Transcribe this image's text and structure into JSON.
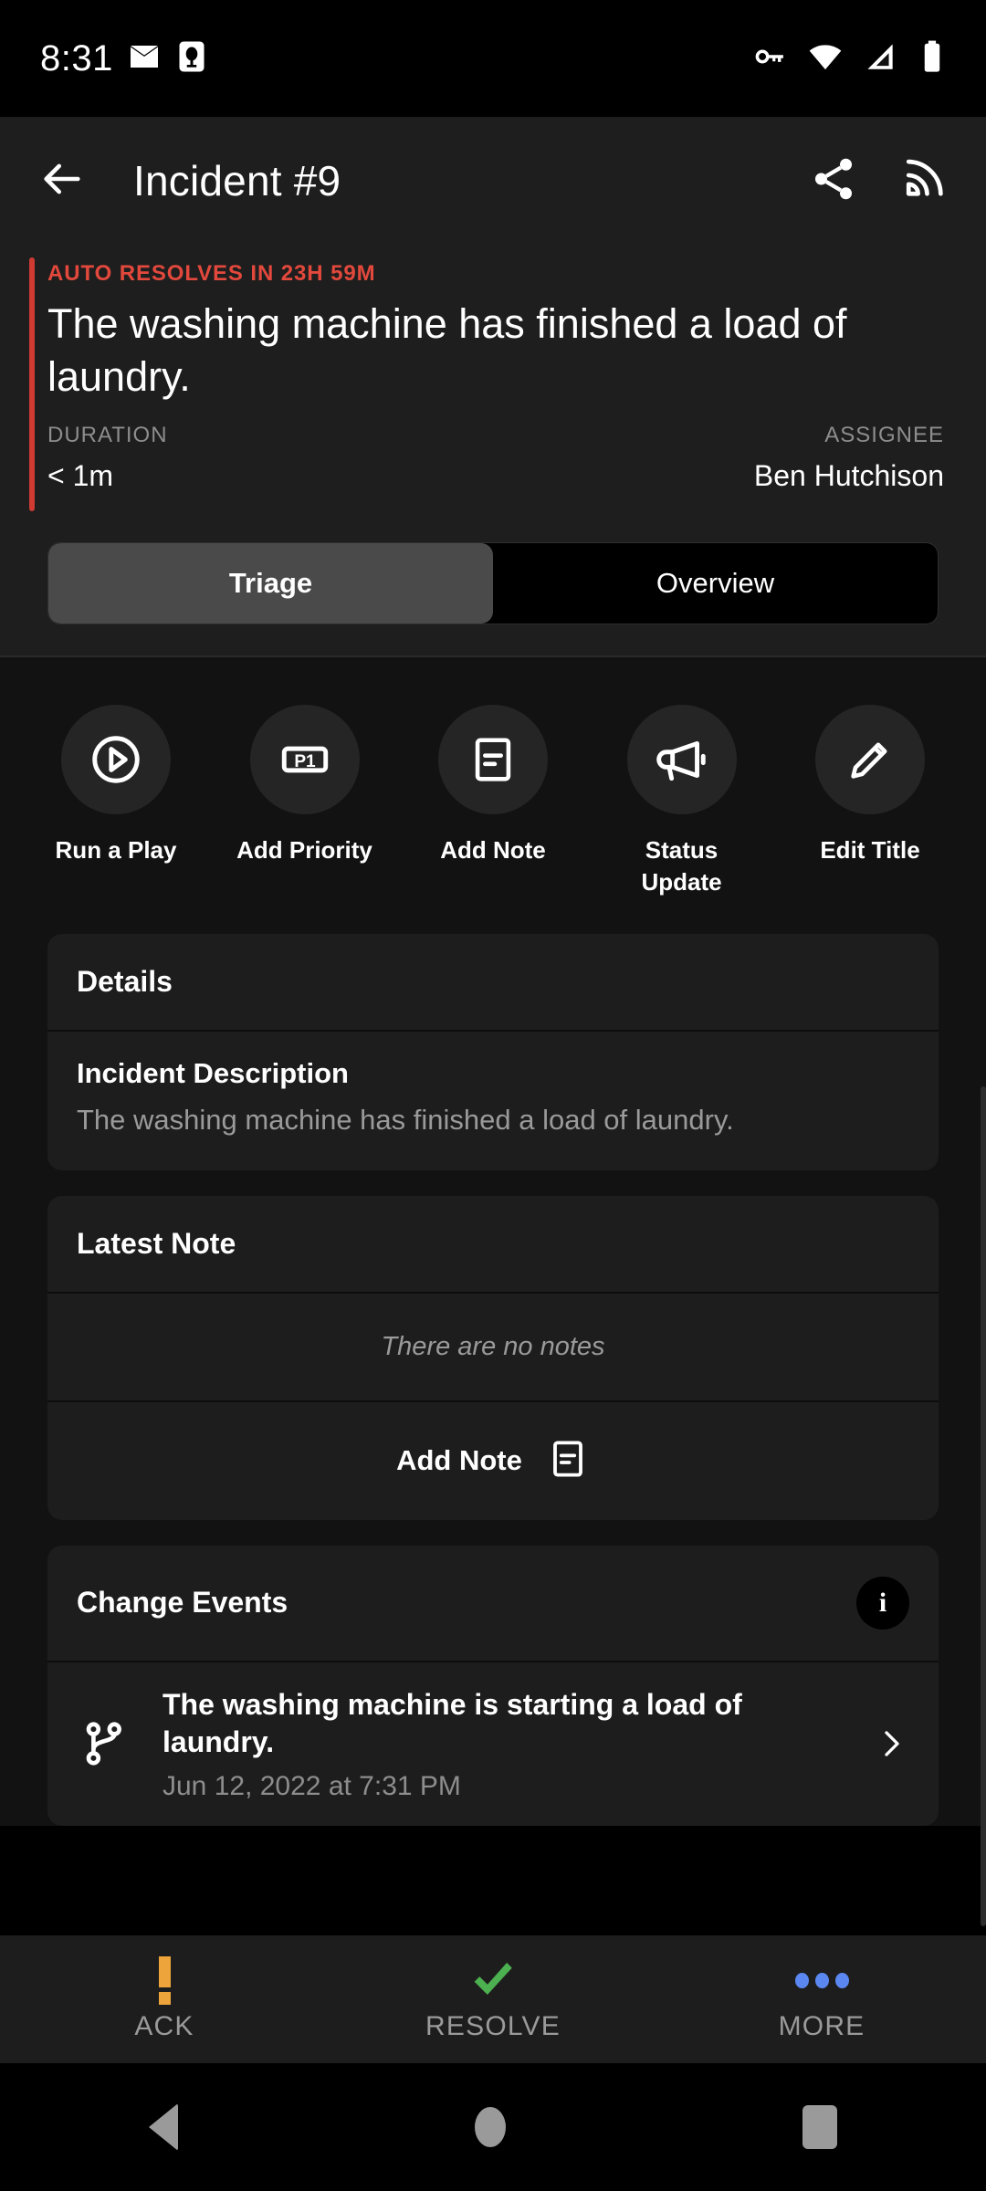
{
  "status_bar": {
    "time": "8:31",
    "left_icons": [
      "mail-icon",
      "app-notification-icon"
    ],
    "right_icons": [
      "vpn-key-icon",
      "wifi-icon",
      "cell-signal-icon",
      "battery-icon"
    ]
  },
  "app_bar": {
    "back_label": "back-arrow",
    "title": "Incident #9",
    "share_label": "share-icon",
    "subscribe_label": "subscribe-icon"
  },
  "summary": {
    "auto_resolve": "AUTO RESOLVES IN 23H 59M",
    "title": "The washing machine has finished a load of laundry.",
    "duration_label": "DURATION",
    "duration_value": "< 1m",
    "assignee_label": "ASSIGNEE",
    "assignee_value": "Ben Hutchison",
    "accent_color": "#cf3a33",
    "auto_resolve_color": "#e2483c"
  },
  "tabs": [
    {
      "label": "Triage",
      "active": true
    },
    {
      "label": "Overview",
      "active": false
    }
  ],
  "quick_actions": [
    {
      "label": "Run a Play",
      "icon": "play-circle-icon"
    },
    {
      "label": "Add Priority",
      "icon": "priority-p1-icon"
    },
    {
      "label": "Add Note",
      "icon": "note-icon"
    },
    {
      "label": "Status Update",
      "icon": "megaphone-icon"
    },
    {
      "label": "Edit Title",
      "icon": "pencil-icon"
    }
  ],
  "details_card": {
    "title": "Details",
    "description_label": "Incident Description",
    "description_value": "The washing machine has finished a load of laundry."
  },
  "latest_note_card": {
    "title": "Latest Note",
    "empty_text": "There are no notes",
    "add_note_label": "Add Note"
  },
  "change_events_card": {
    "title": "Change Events",
    "info_badge": "i",
    "events": [
      {
        "title": "The washing machine is starting a load of laundry.",
        "timestamp": "Jun 12, 2022 at 7:31 PM",
        "icon": "git-branch-icon"
      }
    ]
  },
  "bottom_bar": [
    {
      "label": "ACK",
      "icon": "exclamation-icon",
      "color": "#eda43b"
    },
    {
      "label": "RESOLVE",
      "icon": "check-icon",
      "color": "#4caf50"
    },
    {
      "label": "MORE",
      "icon": "more-dots-icon",
      "color": "#5b87f0"
    }
  ],
  "nav_bar": {
    "back": "nav-back-icon",
    "home": "nav-home-icon",
    "recents": "nav-recents-icon"
  }
}
